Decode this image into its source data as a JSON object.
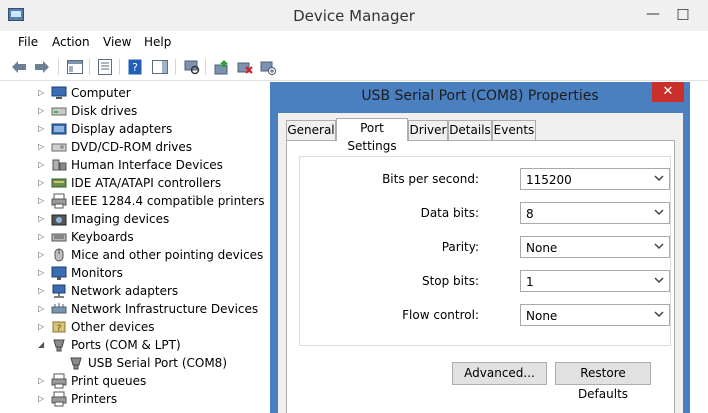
{
  "window": {
    "title": "Device Manager",
    "minimize": "—",
    "maximize": "□"
  },
  "menu": [
    "File",
    "Action",
    "View",
    "Help"
  ],
  "toolbar_icons": [
    "back-arrow-icon",
    "forward-arrow-icon",
    "show-hide-tree-icon",
    "properties-icon",
    "help-icon",
    "action-pane-icon",
    "scan-hardware-icon",
    "update-driver-icon",
    "uninstall-device-icon",
    "add-legacy-icon"
  ],
  "tree": {
    "items": [
      {
        "label": "Computer",
        "expander": "▷",
        "icon": "computer-icon"
      },
      {
        "label": "Disk drives",
        "expander": "▷",
        "icon": "disk-drive-icon"
      },
      {
        "label": "Display adapters",
        "expander": "▷",
        "icon": "display-adapter-icon"
      },
      {
        "label": "DVD/CD-ROM drives",
        "expander": "▷",
        "icon": "dvd-drive-icon"
      },
      {
        "label": "Human Interface Devices",
        "expander": "▷",
        "icon": "hid-icon"
      },
      {
        "label": "IDE ATA/ATAPI controllers",
        "expander": "▷",
        "icon": "ide-controller-icon"
      },
      {
        "label": "IEEE 1284.4 compatible printers",
        "expander": "▷",
        "icon": "printer-icon"
      },
      {
        "label": "Imaging devices",
        "expander": "▷",
        "icon": "camera-icon"
      },
      {
        "label": "Keyboards",
        "expander": "▷",
        "icon": "keyboard-icon"
      },
      {
        "label": "Mice and other pointing devices",
        "expander": "▷",
        "icon": "mouse-icon"
      },
      {
        "label": "Monitors",
        "expander": "▷",
        "icon": "monitor-icon"
      },
      {
        "label": "Network adapters",
        "expander": "▷",
        "icon": "network-adapter-icon"
      },
      {
        "label": "Network Infrastructure Devices",
        "expander": "▷",
        "icon": "network-infrastructure-icon"
      },
      {
        "label": "Other devices",
        "expander": "▷",
        "icon": "other-devices-icon"
      },
      {
        "label": "Ports (COM & LPT)",
        "expander": "◢",
        "icon": "port-icon"
      },
      {
        "label": "USB Serial Port (COM8)",
        "expander": "",
        "icon": "port-icon"
      },
      {
        "label": "Print queues",
        "expander": "▷",
        "icon": "printer-icon"
      },
      {
        "label": "Printers",
        "expander": "▷",
        "icon": "printer-icon"
      }
    ]
  },
  "dialog": {
    "title": "USB Serial Port (COM8) Properties",
    "close": "✕",
    "tabs": [
      "General",
      "Port Settings",
      "Driver",
      "Details",
      "Events"
    ],
    "active_tab": "Port Settings",
    "fields": [
      {
        "label": "Bits per second:",
        "value": "115200"
      },
      {
        "label": "Data bits:",
        "value": "8"
      },
      {
        "label": "Parity:",
        "value": "None"
      },
      {
        "label": "Stop bits:",
        "value": "1"
      },
      {
        "label": "Flow control:",
        "value": "None"
      }
    ],
    "buttons": {
      "advanced": "Advanced...",
      "restore": "Restore Defaults"
    }
  },
  "colors": {
    "dialog_border": "#4a7fc0",
    "close_button": "#c9302c",
    "window_face": "#f0f0f0"
  }
}
